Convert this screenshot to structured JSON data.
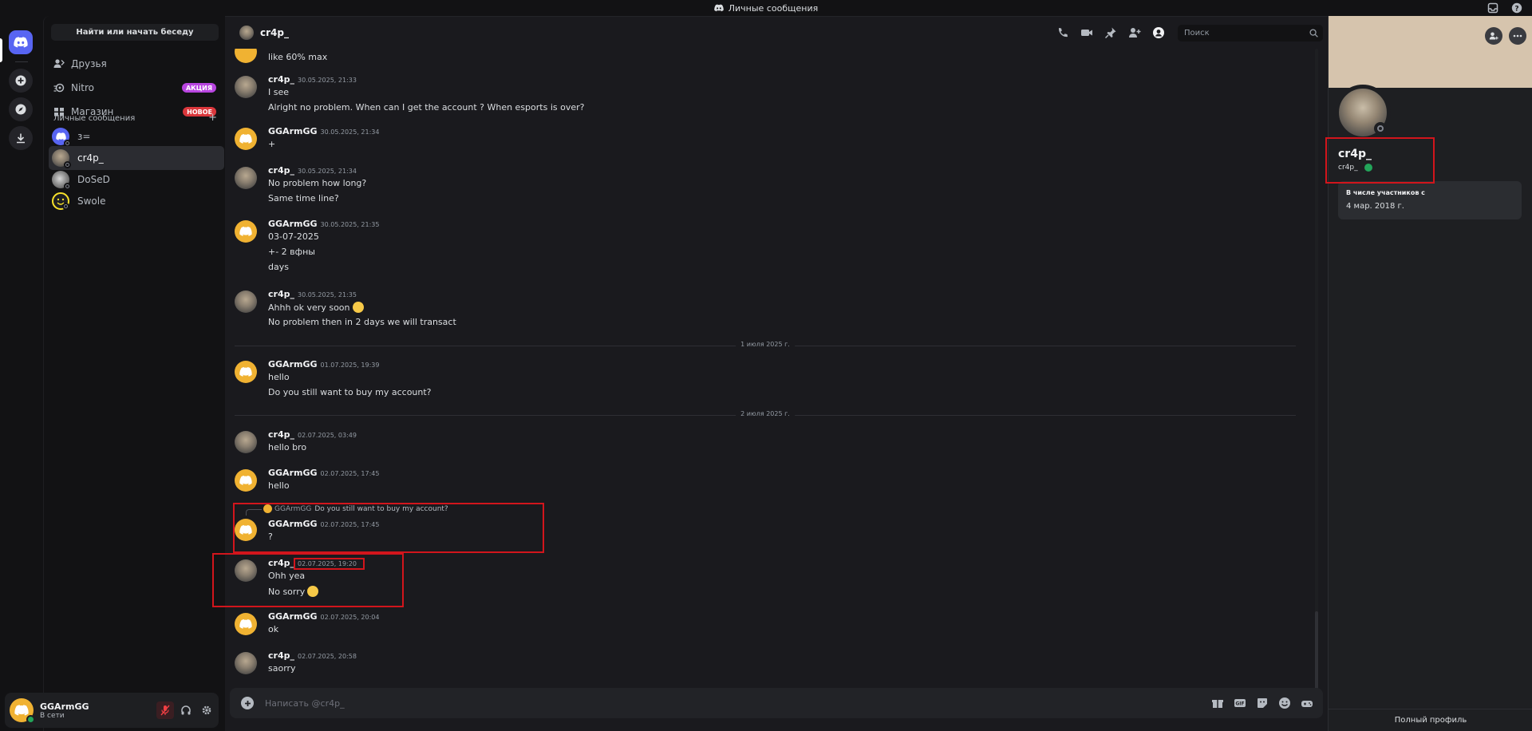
{
  "window": {
    "title": "Личные сообщения"
  },
  "sidebar": {
    "find_label": "Найти или начать беседу",
    "nav": [
      {
        "label": "Друзья",
        "badge": ""
      },
      {
        "label": "Nitro",
        "badge": "АКЦИЯ",
        "badge_color": "#b845e0"
      },
      {
        "label": "Магазин",
        "badge": "НОВОЕ",
        "badge_color": "#da373c"
      }
    ],
    "dm_header": "Личные сообщения",
    "dm_add": "+",
    "dms": [
      {
        "name": "з="
      },
      {
        "name": "cr4p_",
        "active": true
      },
      {
        "name": "DoSeD"
      },
      {
        "name": "Swole"
      }
    ]
  },
  "user": {
    "name": "GGArmGG",
    "status": "В сети"
  },
  "channel": {
    "name": "cr4p_"
  },
  "search": {
    "placeholder": "Поиск"
  },
  "messages": {
    "m0": {
      "line1": "like 60% max"
    },
    "m1": {
      "user": "cr4p_",
      "time": "30.05.2025, 21:33",
      "line1": "I see",
      "line2": "Alright no problem. When can I get the account ? When esports is over?"
    },
    "m2": {
      "user": "GGArmGG",
      "time": "30.05.2025, 21:34",
      "line1": "+"
    },
    "m3": {
      "user": "cr4p_",
      "time": "30.05.2025, 21:34",
      "line1": "No problem how long?",
      "line2": "Same time line?"
    },
    "m4": {
      "user": "GGArmGG",
      "time": "30.05.2025, 21:35",
      "line1": "03-07-2025",
      "line2": "+- 2 вфны",
      "line3": "days"
    },
    "m5": {
      "user": "cr4p_",
      "time": "30.05.2025, 21:35",
      "line1": "Ahhh ok very soon",
      "line2": "No problem then in 2 days we will transact"
    },
    "div1": "1 июля 2025 г.",
    "m6": {
      "user": "GGArmGG",
      "time": "01.07.2025, 19:39",
      "line1": "hello",
      "line2": "Do you still want to buy my account?"
    },
    "div2": "2 июля 2025 г.",
    "m7": {
      "user": "cr4p_",
      "time": "02.07.2025, 03:49",
      "line1": "hello bro"
    },
    "m8": {
      "user": "GGArmGG",
      "time": "02.07.2025, 17:45",
      "line1": "hello"
    },
    "m9": {
      "reply_user": "GGArmGG",
      "reply_text": "Do you still want to buy my account?",
      "user": "GGArmGG",
      "time": "02.07.2025, 17:45",
      "line1": "?"
    },
    "m10": {
      "user": "cr4p_",
      "time": "02.07.2025, 19:20",
      "line1": "Ohh yea",
      "line2": "No sorry"
    },
    "m11": {
      "user": "GGArmGG",
      "time": "02.07.2025, 20:04",
      "line1": "ok"
    },
    "m12": {
      "user": "cr4p_",
      "time": "02.07.2025, 20:58",
      "line1": "saorry"
    }
  },
  "composer": {
    "placeholder": "Написать @cr4p_"
  },
  "profile": {
    "display_name": "cr4p_",
    "username": "cr4p_",
    "member_since_label": "В числе участников с",
    "member_since": "4 мар. 2018 г.",
    "full_profile": "Полный профиль"
  },
  "icons": [
    "discord-icon",
    "inbox-icon",
    "help-icon",
    "add-server-icon",
    "discover-icon",
    "download-icon",
    "friends-icon",
    "nitro-icon",
    "shop-icon",
    "call-icon",
    "video-icon",
    "pin-icon",
    "add-friend-icon",
    "profile-toggle-icon",
    "search-icon",
    "gift-icon",
    "gif-icon",
    "sticker-icon",
    "emoji-icon",
    "apps-icon",
    "mute-icon",
    "headphones-icon",
    "settings-icon"
  ],
  "colors": {
    "accent": "#5865f2",
    "online": "#23a55a",
    "highlight": "#d2151c",
    "avatar_gg": "#f0b232"
  }
}
